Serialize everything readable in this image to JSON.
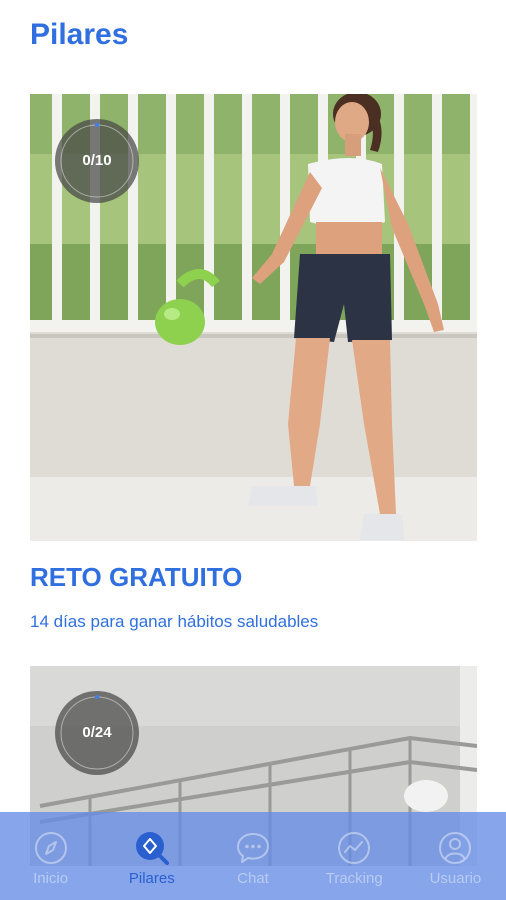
{
  "header": {
    "title": "Pilares"
  },
  "cards": [
    {
      "progress": "0/10",
      "title": "RETO GRATUITO",
      "subtitle": "14 días para ganar hábitos saludables"
    },
    {
      "progress": "0/24"
    }
  ],
  "bottom_nav": {
    "items": [
      {
        "label": "Inicio",
        "icon": "compass-icon",
        "active": false
      },
      {
        "label": "Pilares",
        "icon": "search-icon",
        "active": true
      },
      {
        "label": "Chat",
        "icon": "chat-icon",
        "active": false
      },
      {
        "label": "Tracking",
        "icon": "tracking-icon",
        "active": false
      },
      {
        "label": "Usuario",
        "icon": "user-icon",
        "active": false
      }
    ]
  },
  "colors": {
    "accent": "#2f6fe0",
    "nav_background": "#648ce6"
  }
}
